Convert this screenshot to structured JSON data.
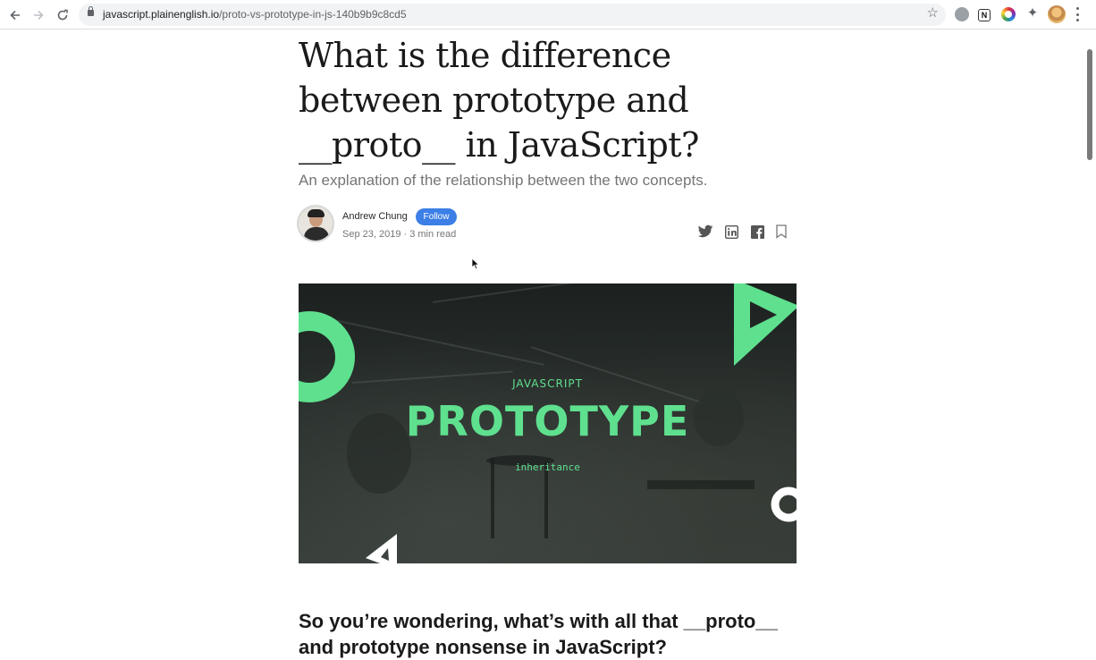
{
  "browser": {
    "url_host": "javascript.plainenglish.io",
    "url_path": "/proto-vs-prototype-in-js-140b9b9c8cd5",
    "icons": {
      "back": "arrow-left-icon",
      "forward": "arrow-right-icon",
      "reload": "reload-icon",
      "secure": "lock-icon",
      "bookmark": "star-icon",
      "menu": "more-vertical-icon"
    },
    "extensions": [
      "globe-icon",
      "notion-icon",
      "color-picker-icon",
      "puzzle-icon",
      "profile-avatar"
    ]
  },
  "article": {
    "title": "What is the difference between prototype and __proto__ in JavaScript?",
    "subtitle": "An explanation of the relationship between the two concepts.",
    "author": {
      "name": "Andrew Chung",
      "follow_label": "Follow",
      "meta": "Sep 23, 2019 · 3 min read"
    },
    "share_icons": [
      "twitter-icon",
      "linkedin-icon",
      "facebook-icon",
      "bookmark-icon"
    ],
    "hero": {
      "kicker": "JAVASCRIPT",
      "title": "PROTOTYPE",
      "subtitle": "inheritance",
      "accent_color": "#5fe08f"
    },
    "first_heading": "So you’re wondering, what’s with all that __proto__ and prototype nonsense in JavaScript?"
  },
  "colors": {
    "follow_button": "#3c7fe6",
    "meta_text": "#757575",
    "title_text": "#1a1a1a"
  }
}
